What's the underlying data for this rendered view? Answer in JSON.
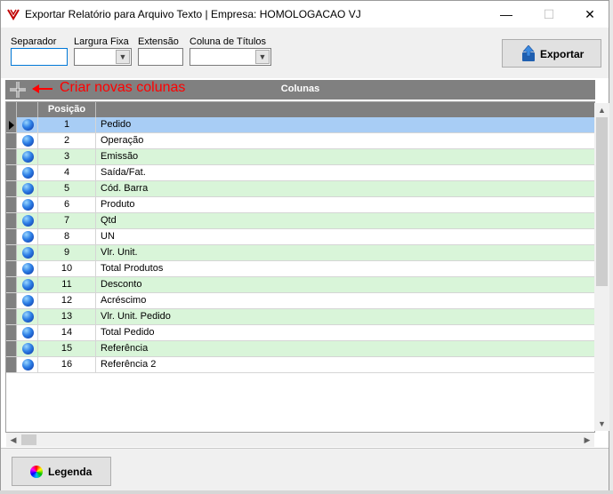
{
  "window": {
    "title": "Exportar Relatório para Arquivo Texto | Empresa: HOMOLOGACAO VJ",
    "controls": {
      "minimize": "—",
      "maximize": "☐",
      "close": "✕"
    }
  },
  "toolbar": {
    "separador_label": "Separador",
    "largura_label": "Largura Fixa",
    "extensao_label": "Extensão",
    "coluna_titulos_label": "Coluna de Títulos",
    "separador_value": "",
    "extensao_value": "",
    "export_label": "Exportar"
  },
  "grid": {
    "title": "Colunas",
    "annotation": "Criar novas colunas",
    "columns": [
      "",
      "",
      "Posição",
      ""
    ],
    "rows": [
      {
        "pos": "1",
        "name": "Pedido",
        "style": "sel"
      },
      {
        "pos": "2",
        "name": "Operação",
        "style": ""
      },
      {
        "pos": "3",
        "name": "Emissão",
        "style": "alt"
      },
      {
        "pos": "4",
        "name": "Saída/Fat.",
        "style": ""
      },
      {
        "pos": "5",
        "name": "Cód. Barra",
        "style": "alt"
      },
      {
        "pos": "6",
        "name": "Produto",
        "style": ""
      },
      {
        "pos": "7",
        "name": "Qtd",
        "style": "alt"
      },
      {
        "pos": "8",
        "name": "UN",
        "style": ""
      },
      {
        "pos": "9",
        "name": "Vlr. Unit.",
        "style": "alt"
      },
      {
        "pos": "10",
        "name": "Total Produtos",
        "style": ""
      },
      {
        "pos": "11",
        "name": "Desconto",
        "style": "alt"
      },
      {
        "pos": "12",
        "name": "Acréscimo",
        "style": ""
      },
      {
        "pos": "13",
        "name": "Vlr. Unit. Pedido",
        "style": "alt"
      },
      {
        "pos": "14",
        "name": "Total Pedido",
        "style": ""
      },
      {
        "pos": "15",
        "name": "Referência",
        "style": "alt"
      },
      {
        "pos": "16",
        "name": "Referência 2",
        "style": ""
      }
    ]
  },
  "footer": {
    "legend_label": "Legenda"
  },
  "colors": {
    "selected_row": "#a8cdf5",
    "alt_row": "#d9f5d9",
    "header_gray": "#808080",
    "annotation": "#ff0000"
  }
}
